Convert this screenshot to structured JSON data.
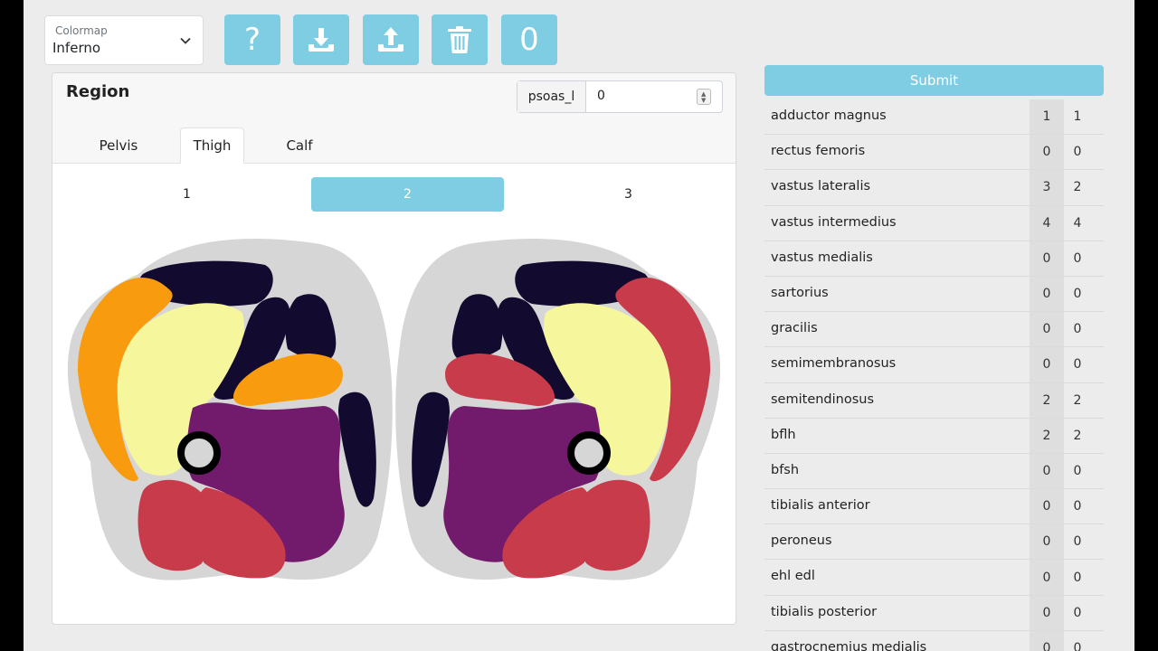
{
  "colormap": {
    "label": "Colormap",
    "value": "Inferno"
  },
  "toolbar": {
    "help_glyph": "?",
    "zero_glyph": "0",
    "button_color": "#7ecde3"
  },
  "region": {
    "title": "Region",
    "psoas_label": "psoas_l",
    "psoas_value": "0",
    "tabs": [
      "Pelvis",
      "Thigh",
      "Calf"
    ],
    "active_tab": "Thigh",
    "subtabs": [
      "1",
      "2",
      "3"
    ],
    "active_subtab": "2"
  },
  "muscle_colors": {
    "orange": "#f89b0e",
    "yellow": "#f6f79d",
    "dark": "#120a2f",
    "purple": "#721b6d",
    "red": "#c83b4b",
    "skin": "#d6d6d6"
  },
  "submit_label": "Submit",
  "scores": [
    {
      "name": "adductor magnus",
      "left": "1",
      "right": "1"
    },
    {
      "name": "rectus femoris",
      "left": "0",
      "right": "0"
    },
    {
      "name": "vastus lateralis",
      "left": "3",
      "right": "2"
    },
    {
      "name": "vastus intermedius",
      "left": "4",
      "right": "4"
    },
    {
      "name": "vastus medialis",
      "left": "0",
      "right": "0"
    },
    {
      "name": "sartorius",
      "left": "0",
      "right": "0"
    },
    {
      "name": "gracilis",
      "left": "0",
      "right": "0"
    },
    {
      "name": "semimembranosus",
      "left": "0",
      "right": "0"
    },
    {
      "name": "semitendinosus",
      "left": "2",
      "right": "2"
    },
    {
      "name": "bflh",
      "left": "2",
      "right": "2"
    },
    {
      "name": "bfsh",
      "left": "0",
      "right": "0"
    },
    {
      "name": "tibialis anterior",
      "left": "0",
      "right": "0"
    },
    {
      "name": "peroneus",
      "left": "0",
      "right": "0"
    },
    {
      "name": "ehl edl",
      "left": "0",
      "right": "0"
    },
    {
      "name": "tibialis posterior",
      "left": "0",
      "right": "0"
    },
    {
      "name": "gastrocnemius medialis",
      "left": "0",
      "right": "0"
    }
  ]
}
